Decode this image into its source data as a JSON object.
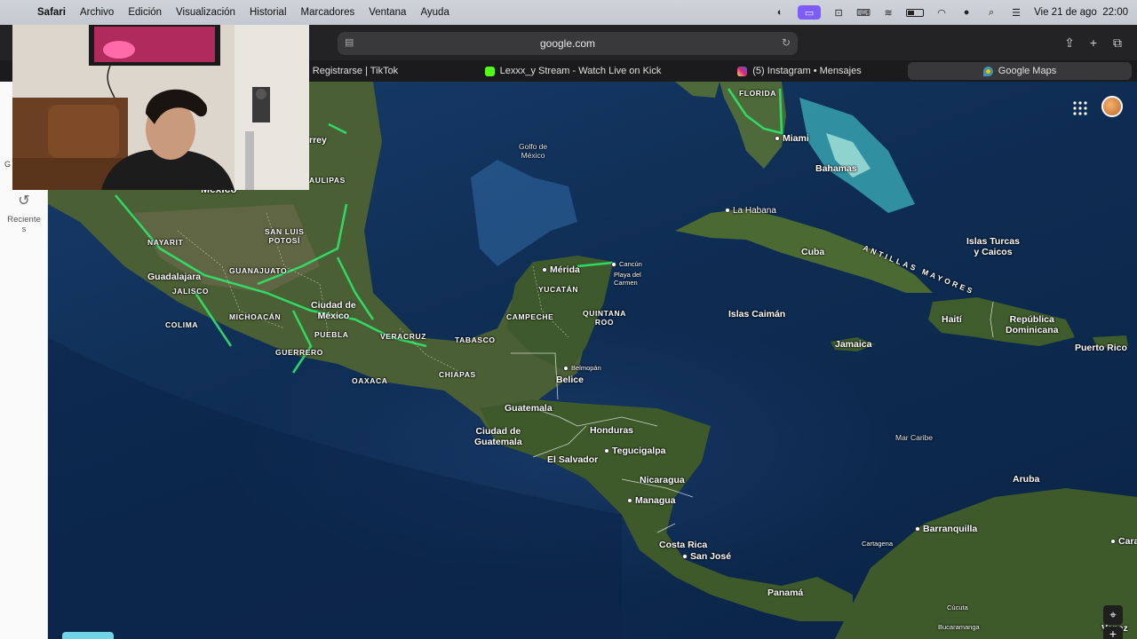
{
  "menubar": {
    "app": "Safari",
    "items": [
      "Archivo",
      "Edición",
      "Visualización",
      "Historial",
      "Marcadores",
      "Ventana",
      "Ayuda"
    ],
    "clock": "Vie 21 de ago  22:00"
  },
  "toolbar": {
    "url": "google.com"
  },
  "tabs": [
    {
      "label": "Registrarse | TikTok"
    },
    {
      "label": "Lexxx_y Stream - Watch Live on Kick",
      "color": "#53fc18"
    },
    {
      "label": "(5) Instagram • Mensajes",
      "color": "#e1306c"
    },
    {
      "label": "Google Maps",
      "color": "#34a853"
    }
  ],
  "sidebar": {
    "g_text": "G",
    "recents_label": "Reciente\ns"
  },
  "map": {
    "labels": {
      "florida": "FLORIDA",
      "miami": "Miami",
      "bahamas": "Bahamas",
      "la_habana": "La Habana",
      "cuba": "Cuba",
      "antillas": "ANTILLAS MAYORES",
      "turcas": "Islas Turcas\ny Caicos",
      "golfo": "Golfo de\nMéxico",
      "monterrey": "rrey",
      "tamaulipas": "AULIPAS",
      "mexico": "México",
      "nayarit": "NAYARIT",
      "san_luis": "SAN LUIS\nPOTOSÍ",
      "guanajuato": "GUANAJUATO",
      "guadalajara": "Guadalajara",
      "jalisco": "JALISCO",
      "michoacan": "MICHOACÁN",
      "colima": "COLIMA",
      "cdmx": "Ciudad de\nMéxico",
      "puebla": "PUEBLA",
      "guerrero": "GUERRERO",
      "veracruz": "VERACRUZ",
      "oaxaca": "OAXACA",
      "tabasco": "TABASCO",
      "chiapas": "CHIAPAS",
      "merida": "Mérida",
      "cancun": "Cancún",
      "playa": "Playa del\nCarmen",
      "yucatan": "YUCATÁN",
      "campeche": "CAMPECHE",
      "quintana": "QUINTANA\nROO",
      "belmopan": "Belmopán",
      "belice": "Belice",
      "guatemala": "Guatemala",
      "ciudad_guatemala": "Ciudad de\nGuatemala",
      "honduras": "Honduras",
      "tegucigalpa": "Tegucigalpa",
      "el_salvador": "El Salvador",
      "nicaragua": "Nicaragua",
      "managua": "Managua",
      "costa_rica": "Costa Rica",
      "san_jose": "San José",
      "panama": "Panamá",
      "caiman": "Islas Caimán",
      "jamaica": "Jamaica",
      "haiti": "Haití",
      "rep_dom": "República\nDominicana",
      "puerto_rico": "Puerto Rico",
      "mar_caribe": "Mar Caribe",
      "aruba": "Aruba",
      "cartagena": "Cartagena",
      "barranquilla": "Barranquilla",
      "cucuta": "Cúcuta",
      "bucaramanga": "Bucaramanga",
      "caracas": "Cara",
      "venezuela": "Venez"
    }
  }
}
